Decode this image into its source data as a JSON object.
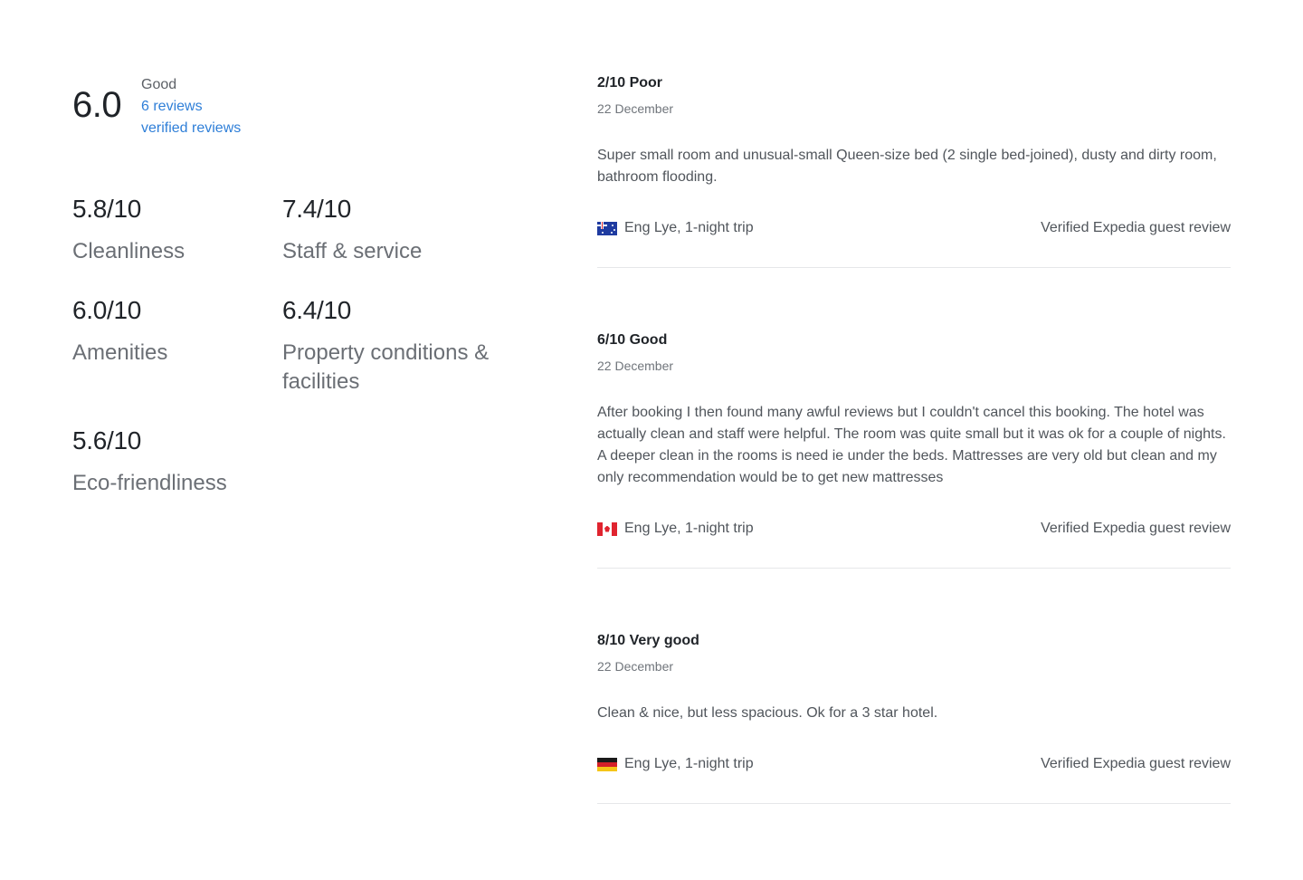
{
  "summary": {
    "overall_score": "6.0",
    "overall_label": "Good",
    "reviews_link": "6 reviews",
    "verified_link": "verified reviews",
    "categories": [
      {
        "score": "5.8/10",
        "name": "Cleanliness"
      },
      {
        "score": "7.4/10",
        "name": "Staff & service"
      },
      {
        "score": "6.0/10",
        "name": "Amenities"
      },
      {
        "score": "6.4/10",
        "name": "Property conditions & facilities"
      },
      {
        "score": "5.6/10",
        "name": "Eco-friendliness"
      }
    ]
  },
  "reviews": [
    {
      "title": "2/10 Poor",
      "date": "22 December",
      "text": "Super small room and unusual-small Queen-size bed (2 single bed-joined), dusty and dirty room, bathroom flooding.",
      "author": "Eng Lye, 1-night trip",
      "flag": "australia-flag-icon",
      "verified": "Verified Expedia guest review"
    },
    {
      "title": "6/10 Good",
      "date": "22 December",
      "text": "After booking I then found many awful reviews but I couldn't cancel this booking. The hotel was actually clean and staff were helpful. The room was quite small but it was ok for a couple of nights. A deeper clean in the rooms is need ie under the beds. Mattresses are very old but clean and my only recommendation would be to get new mattresses",
      "author": "Eng Lye, 1-night trip",
      "flag": "canada-flag-icon",
      "verified": "Verified Expedia guest review"
    },
    {
      "title": "8/10 Very good",
      "date": "22 December",
      "text": "Clean & nice, but less spacious. Ok for a 3 star hotel.",
      "author": "Eng Lye, 1-night trip",
      "flag": "germany-flag-icon",
      "verified": "Verified Expedia guest review"
    }
  ],
  "colors": {
    "link": "#2f7fd8",
    "text_dark": "#1f2328",
    "text_muted": "#6b6f75",
    "divider": "#e6e7e9"
  }
}
